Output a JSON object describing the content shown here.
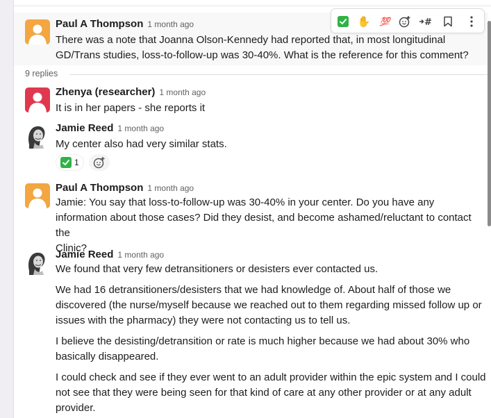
{
  "colors": {
    "accent_green": "#2fb344",
    "avatar_orange": "#f3a641",
    "avatar_red": "#e0384f",
    "muted_text": "#616061"
  },
  "parent_message": {
    "sender": "Paul A Thompson",
    "timestamp": "1 month ago",
    "lines": [
      "There was a note that Joanna Olson-Kennedy had reported that, in most longitudinal",
      "GD/Trans studies, loss-to-follow-up was 30-40%. What is the reference for this comment?"
    ]
  },
  "toolbar": {
    "icons": [
      "check-mark-reaction-icon",
      "raised-hand-reaction-icon",
      "hundred-points-reaction-icon",
      "add-reaction-icon",
      "forward-to-channel-icon",
      "bookmark-icon",
      "more-actions-icon"
    ],
    "hundred_label": "💯",
    "hand_label": "✋",
    "channel_label": "#"
  },
  "replies": {
    "label": "9 replies"
  },
  "messages": [
    {
      "sender": "Zhenya (researcher)",
      "timestamp": "1 month ago",
      "lines": [
        "It is in her papers - she reports it"
      ]
    },
    {
      "sender": "Jamie Reed",
      "timestamp": "1 month ago",
      "lines": [
        "My center also had very similar stats."
      ],
      "reaction": {
        "emoji": "check-mark",
        "count": "1"
      }
    },
    {
      "sender": "Paul A Thompson",
      "timestamp": "1 month ago",
      "lines": [
        "Jamie: You say that loss-to-follow-up was 30-40% in your center. Do you have any",
        "information about those cases? Did they desist, and become ashamed/reluctant to contact the",
        "Clinic?"
      ]
    },
    {
      "sender": "Jamie Reed",
      "timestamp": "1 month ago",
      "paragraphs": [
        [
          "We found that very few detransitioners or desisters ever contacted us."
        ],
        [
          "We had 16 detransitioners/desisters that we had knowledge of. About half of those we",
          "discovered (the nurse/myself because we reached out to them regarding missed follow up or",
          "issues with the pharmacy) they were not contacting us to tell us."
        ],
        [
          "I believe the desisting/detransition or rate is much higher because we had about 30% who",
          "basically disappeared."
        ],
        [
          "I could check and see if they ever went to an adult provider within the epic system and I could",
          "not see that they were being seen for that kind of care at any other provider or at any adult",
          "provider."
        ]
      ]
    }
  ]
}
